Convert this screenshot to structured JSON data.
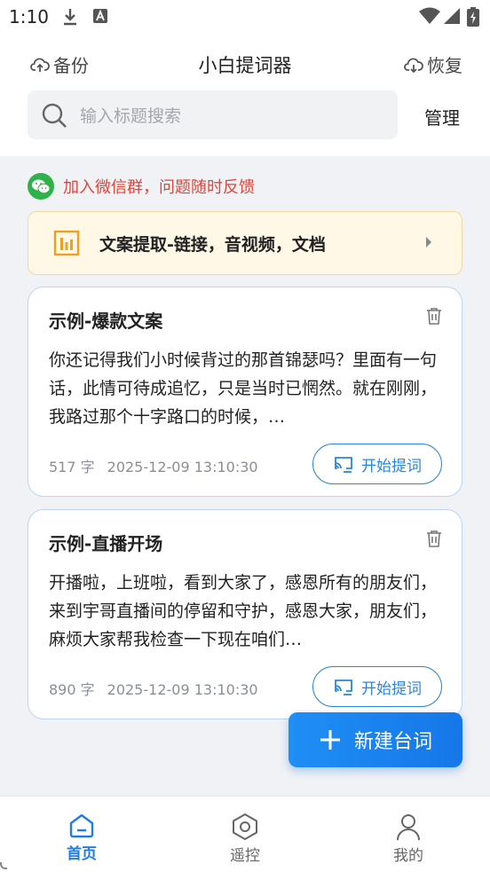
{
  "status_bar": {
    "time": "1:10"
  },
  "header": {
    "backup_label": "备份",
    "title": "小白提词器",
    "restore_label": "恢复"
  },
  "search": {
    "placeholder": "输入标题搜索",
    "manage_label": "管理"
  },
  "wechat_notice": {
    "text": "加入微信群，问题随时反馈"
  },
  "extract_banner": {
    "text": "文案提取-链接，音视频，文档"
  },
  "scripts": [
    {
      "title": "示例-爆款文案",
      "body": "你还记得我们小时候背过的那首锦瑟吗？里面有一句话，此情可待成追忆，只是当时已惘然。就在刚刚，我路过那个十字路口的时候，…",
      "word_count": "517 字",
      "timestamp": "2025-12-09 13:10:30",
      "start_label": "开始提词"
    },
    {
      "title": "示例-直播开场",
      "body": "开播啦，上班啦，看到大家了，感恩所有的朋友们，来到宇哥直播间的停留和守护，感恩大家，朋友们，麻烦大家帮我检查一下现在咱们…",
      "word_count": "890 字",
      "timestamp": "2025-12-09 13:10:30",
      "start_label": "开始提词"
    }
  ],
  "fab": {
    "label": "新建台词"
  },
  "bottom_nav": [
    {
      "label": "首页",
      "icon": "home-icon",
      "active": true
    },
    {
      "label": "遥控",
      "icon": "hexagon-icon",
      "active": false
    },
    {
      "label": "我的",
      "icon": "user-icon",
      "active": false
    }
  ],
  "colors": {
    "accent": "#1d7fe6",
    "notice_red": "#e0453a",
    "wechat_green": "#2fb24a",
    "banner_bg": "#fff8e6",
    "banner_icon": "#f0a020"
  }
}
